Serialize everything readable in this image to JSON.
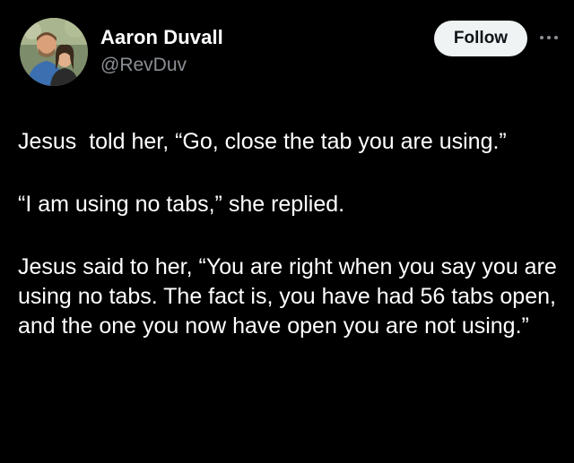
{
  "author": {
    "display_name": "Aaron Duvall",
    "handle": "@RevDuv"
  },
  "actions": {
    "follow_label": "Follow",
    "more_icon": "more-horizontal-icon"
  },
  "post": {
    "paragraphs": [
      "Jesus  told her, “Go, close the tab you are using.”",
      "“I am using no tabs,” she replied.",
      "Jesus said to her, “You are right when you say you are using no tabs. The fact is, you have had 56 tabs open, and the one you now have open you are not using.”"
    ]
  },
  "colors": {
    "background": "#000000",
    "text_primary": "#ffffff",
    "text_secondary": "#8b8f94",
    "follow_bg": "#eff3f4",
    "follow_text": "#0f1419"
  }
}
